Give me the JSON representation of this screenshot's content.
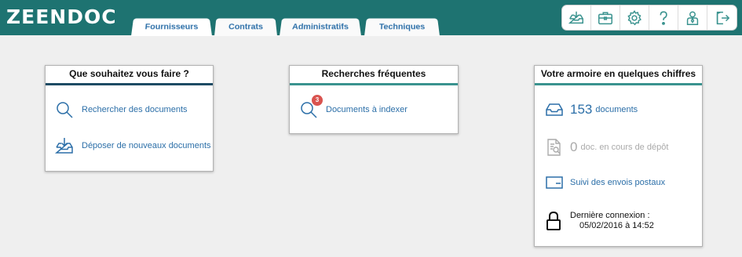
{
  "app": {
    "logo_text": "ZEENDOC"
  },
  "tabs": [
    {
      "label": "Fournisseurs"
    },
    {
      "label": "Contrats"
    },
    {
      "label": "Administratifs"
    },
    {
      "label": "Techniques"
    }
  ],
  "toolbar": {
    "icons": [
      "inbox-download-icon",
      "briefcase-icon",
      "gear-icon",
      "help-icon",
      "user-icon",
      "logout-icon"
    ]
  },
  "actions_card": {
    "title": "Que souhaitez vous faire ?",
    "items": [
      {
        "label": "Rechercher des documents",
        "icon": "search-icon"
      },
      {
        "label": "Déposer de nouveaux documents",
        "icon": "tray-download-icon"
      }
    ]
  },
  "searches_card": {
    "title": "Recherches fréquentes",
    "items": [
      {
        "label": "Documents à indexer",
        "badge": "3",
        "icon": "search-icon"
      }
    ]
  },
  "stats_card": {
    "title": "Votre armoire en quelques chiffres",
    "documents_count": "153",
    "documents_label": "documents",
    "pending_count": "0",
    "pending_label": "doc. en cours de dépôt",
    "postal_label": "Suivi des envois postaux",
    "last_login_label": "Dernière connexion :",
    "last_login_value": "05/02/2016 à 14:52"
  },
  "colors": {
    "topbar": "#1e7371",
    "accent_dark": "#1e4b64",
    "accent_teal": "#3a938f",
    "link": "#2c6fa8",
    "badge": "#d9534f"
  }
}
